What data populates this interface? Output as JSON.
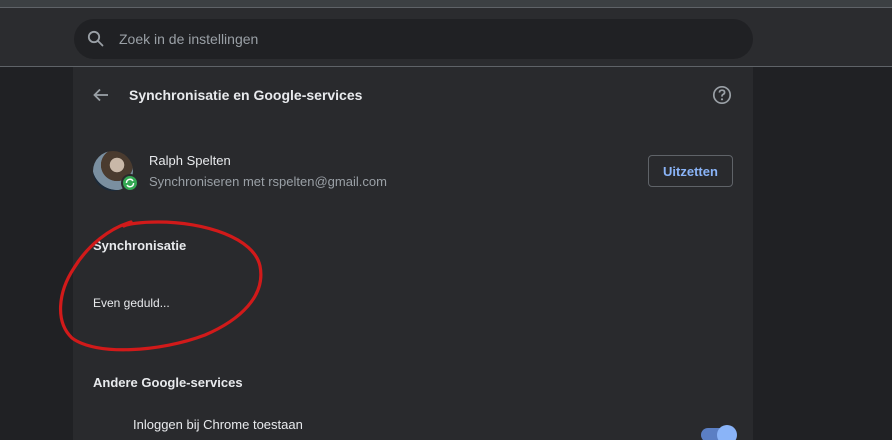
{
  "search": {
    "placeholder": "Zoek in de instellingen"
  },
  "page": {
    "title": "Synchronisatie en Google-services"
  },
  "account": {
    "name": "Ralph Spelten",
    "sync_status": "Synchroniseren met rspelten@gmail.com",
    "off_button": "Uitzetten"
  },
  "sync": {
    "title": "Synchronisatie",
    "loading": "Even geduld..."
  },
  "other_services": {
    "title": "Andere Google-services",
    "allow_signin": {
      "label": "Inloggen bij Chrome toestaan",
      "enabled": true
    }
  },
  "colors": {
    "accent": "#8ab4f8",
    "annotation": "#d11a1a"
  }
}
